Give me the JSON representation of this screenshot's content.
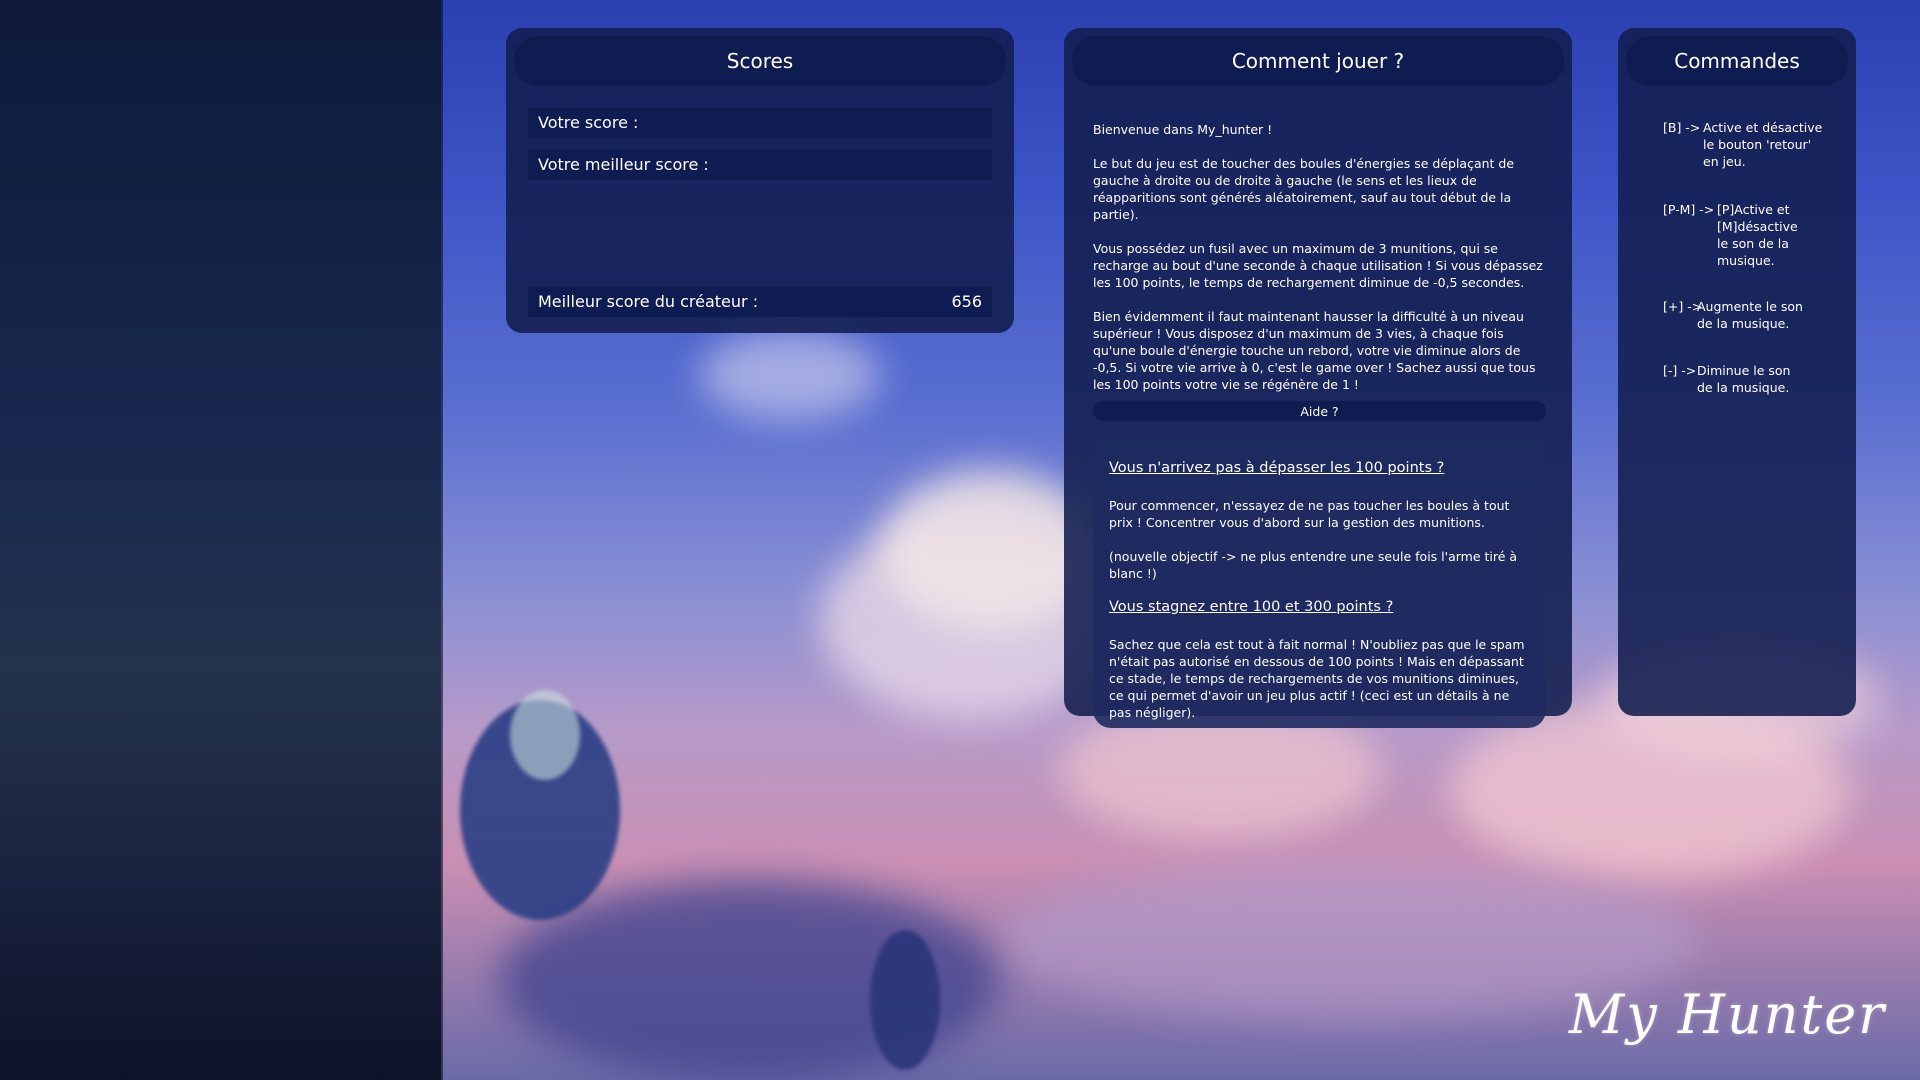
{
  "scores": {
    "title": "Scores",
    "current_label": "Votre score :",
    "best_label": "Votre meilleur score :",
    "creator_label": "Meilleur score du créateur :",
    "creator_value": "656"
  },
  "howto": {
    "title": "Comment jouer ?",
    "paragraphs": [
      "Bienvenue dans My_hunter !",
      "Le but du jeu est de toucher des boules d'énergies se déplaçant de gauche à droite ou de droite à gauche (le sens et les lieux de réapparitions sont générés aléatoirement, sauf au tout début de la partie).",
      "Vous possédez un fusil avec un maximum de 3 munitions, qui se recharge au bout d'une seconde à chaque utilisation ! Si vous dépassez les 100 points, le temps de rechargement diminue de -0,5 secondes.",
      "Bien évidemment il faut maintenant hausser la difficulté à un niveau supérieur ! Vous disposez d'un maximum de 3 vies, à chaque fois qu'une boule d'énergie touche un rebord, votre vie diminue alors de -0,5. Si votre vie arrive à 0, c'est le game over ! Sachez aussi que tous les 100 points votre vie se régénère de 1 !"
    ],
    "help_button": "Aide ?",
    "help": {
      "q1": "Vous n'arrivez pas à dépasser les 100 points ?",
      "a1": "Pour commencer, n'essayez de ne pas toucher les boules à tout prix ! Concentrer vous d'abord sur la gestion des munitions.",
      "a1b": "(nouvelle objectif -> ne plus entendre une seule fois l'arme tiré à blanc !)",
      "q2": "Vous stagnez entre 100 et 300 points ?",
      "a2": "Sachez que cela est tout à fait normal ! N'oubliez pas que le spam n'était pas autorisé en dessous de 100 points ! Mais en dépassant ce stade, le temps de rechargements de vos munitions diminues, ce qui permet d'avoir un jeu plus actif ! (ceci est un détails à ne pas négliger)."
    }
  },
  "commands": {
    "title": "Commandes",
    "items": [
      {
        "key": "[B] ->",
        "desc": "Active et désactive le bouton 'retour' en jeu."
      },
      {
        "key": "[P-M] ->",
        "desc": "[P]Active et [M]désactive le son de la musique."
      },
      {
        "key": "[+] ->",
        "desc": "Augmente le son de la musique."
      },
      {
        "key": "[-] ->",
        "desc": "Diminue le son de la musique."
      }
    ]
  },
  "logo": "My Hunter",
  "colors": {
    "panel_bg": "#121e4e",
    "header_bg": "#0e1c52",
    "text": "#ffffff"
  }
}
